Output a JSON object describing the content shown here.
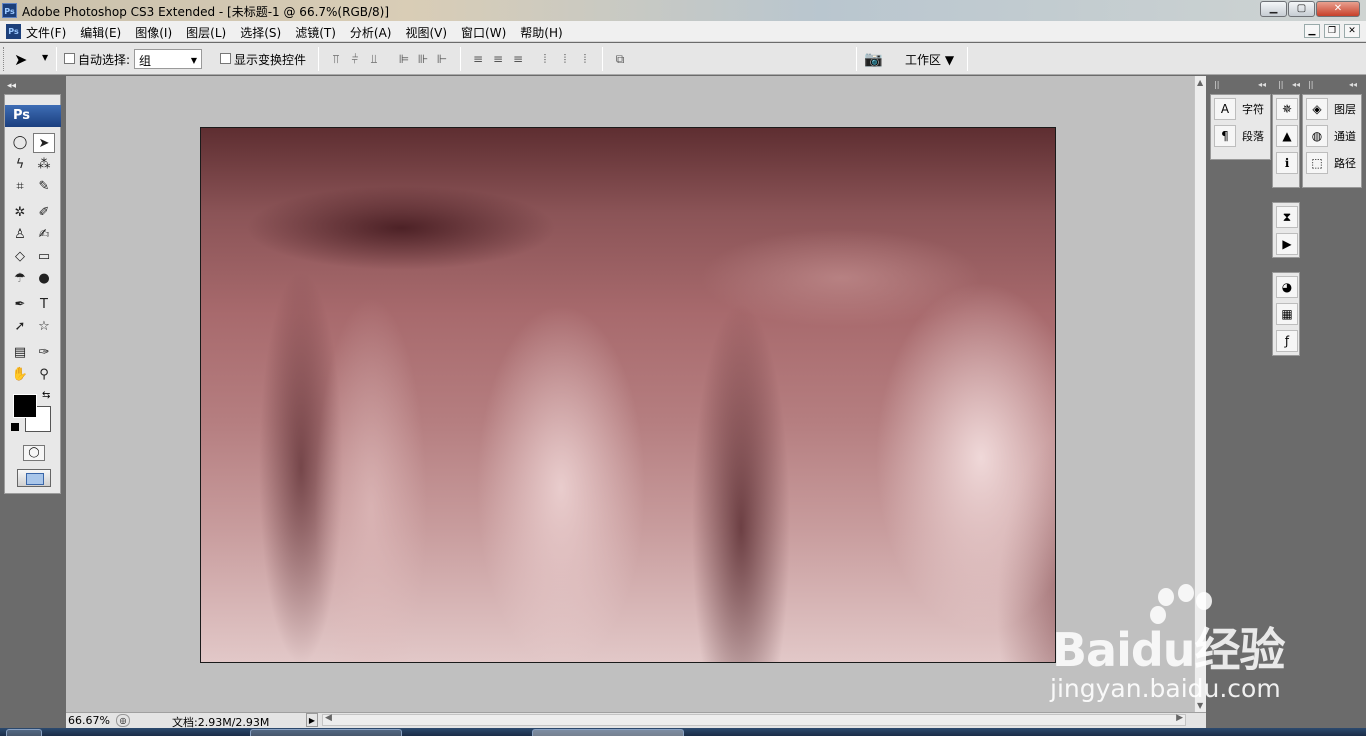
{
  "window": {
    "title": "Adobe Photoshop CS3 Extended - [未标题-1 @ 66.7%(RGB/8)]",
    "app_icon": "Ps"
  },
  "menu": {
    "items": [
      "文件(F)",
      "编辑(E)",
      "图像(I)",
      "图层(L)",
      "选择(S)",
      "滤镜(T)",
      "分析(A)",
      "视图(V)",
      "窗口(W)",
      "帮助(H)"
    ]
  },
  "options": {
    "auto_select_label": "自动选择:",
    "auto_select_value": "组",
    "show_transform_label": "显示变换控件",
    "workspace_label": "工作区"
  },
  "toolbox": {
    "badge": "Ps"
  },
  "panels": {
    "dock1": [
      {
        "label": "字符",
        "icon": "character-icon"
      },
      {
        "label": "段落",
        "icon": "paragraph-icon"
      }
    ],
    "dock3": [
      {
        "label": "图层",
        "icon": "layers-icon"
      },
      {
        "label": "通道",
        "icon": "channels-icon"
      },
      {
        "label": "路径",
        "icon": "paths-icon"
      }
    ]
  },
  "status": {
    "zoom": "66.67%",
    "doc_info": "文档:2.93M/2.93M"
  },
  "watermark": {
    "brand": "Baidu经验",
    "url": "jingyan.baidu.com"
  },
  "colors": {
    "foreground": "#000000",
    "background": "#ffffff"
  }
}
